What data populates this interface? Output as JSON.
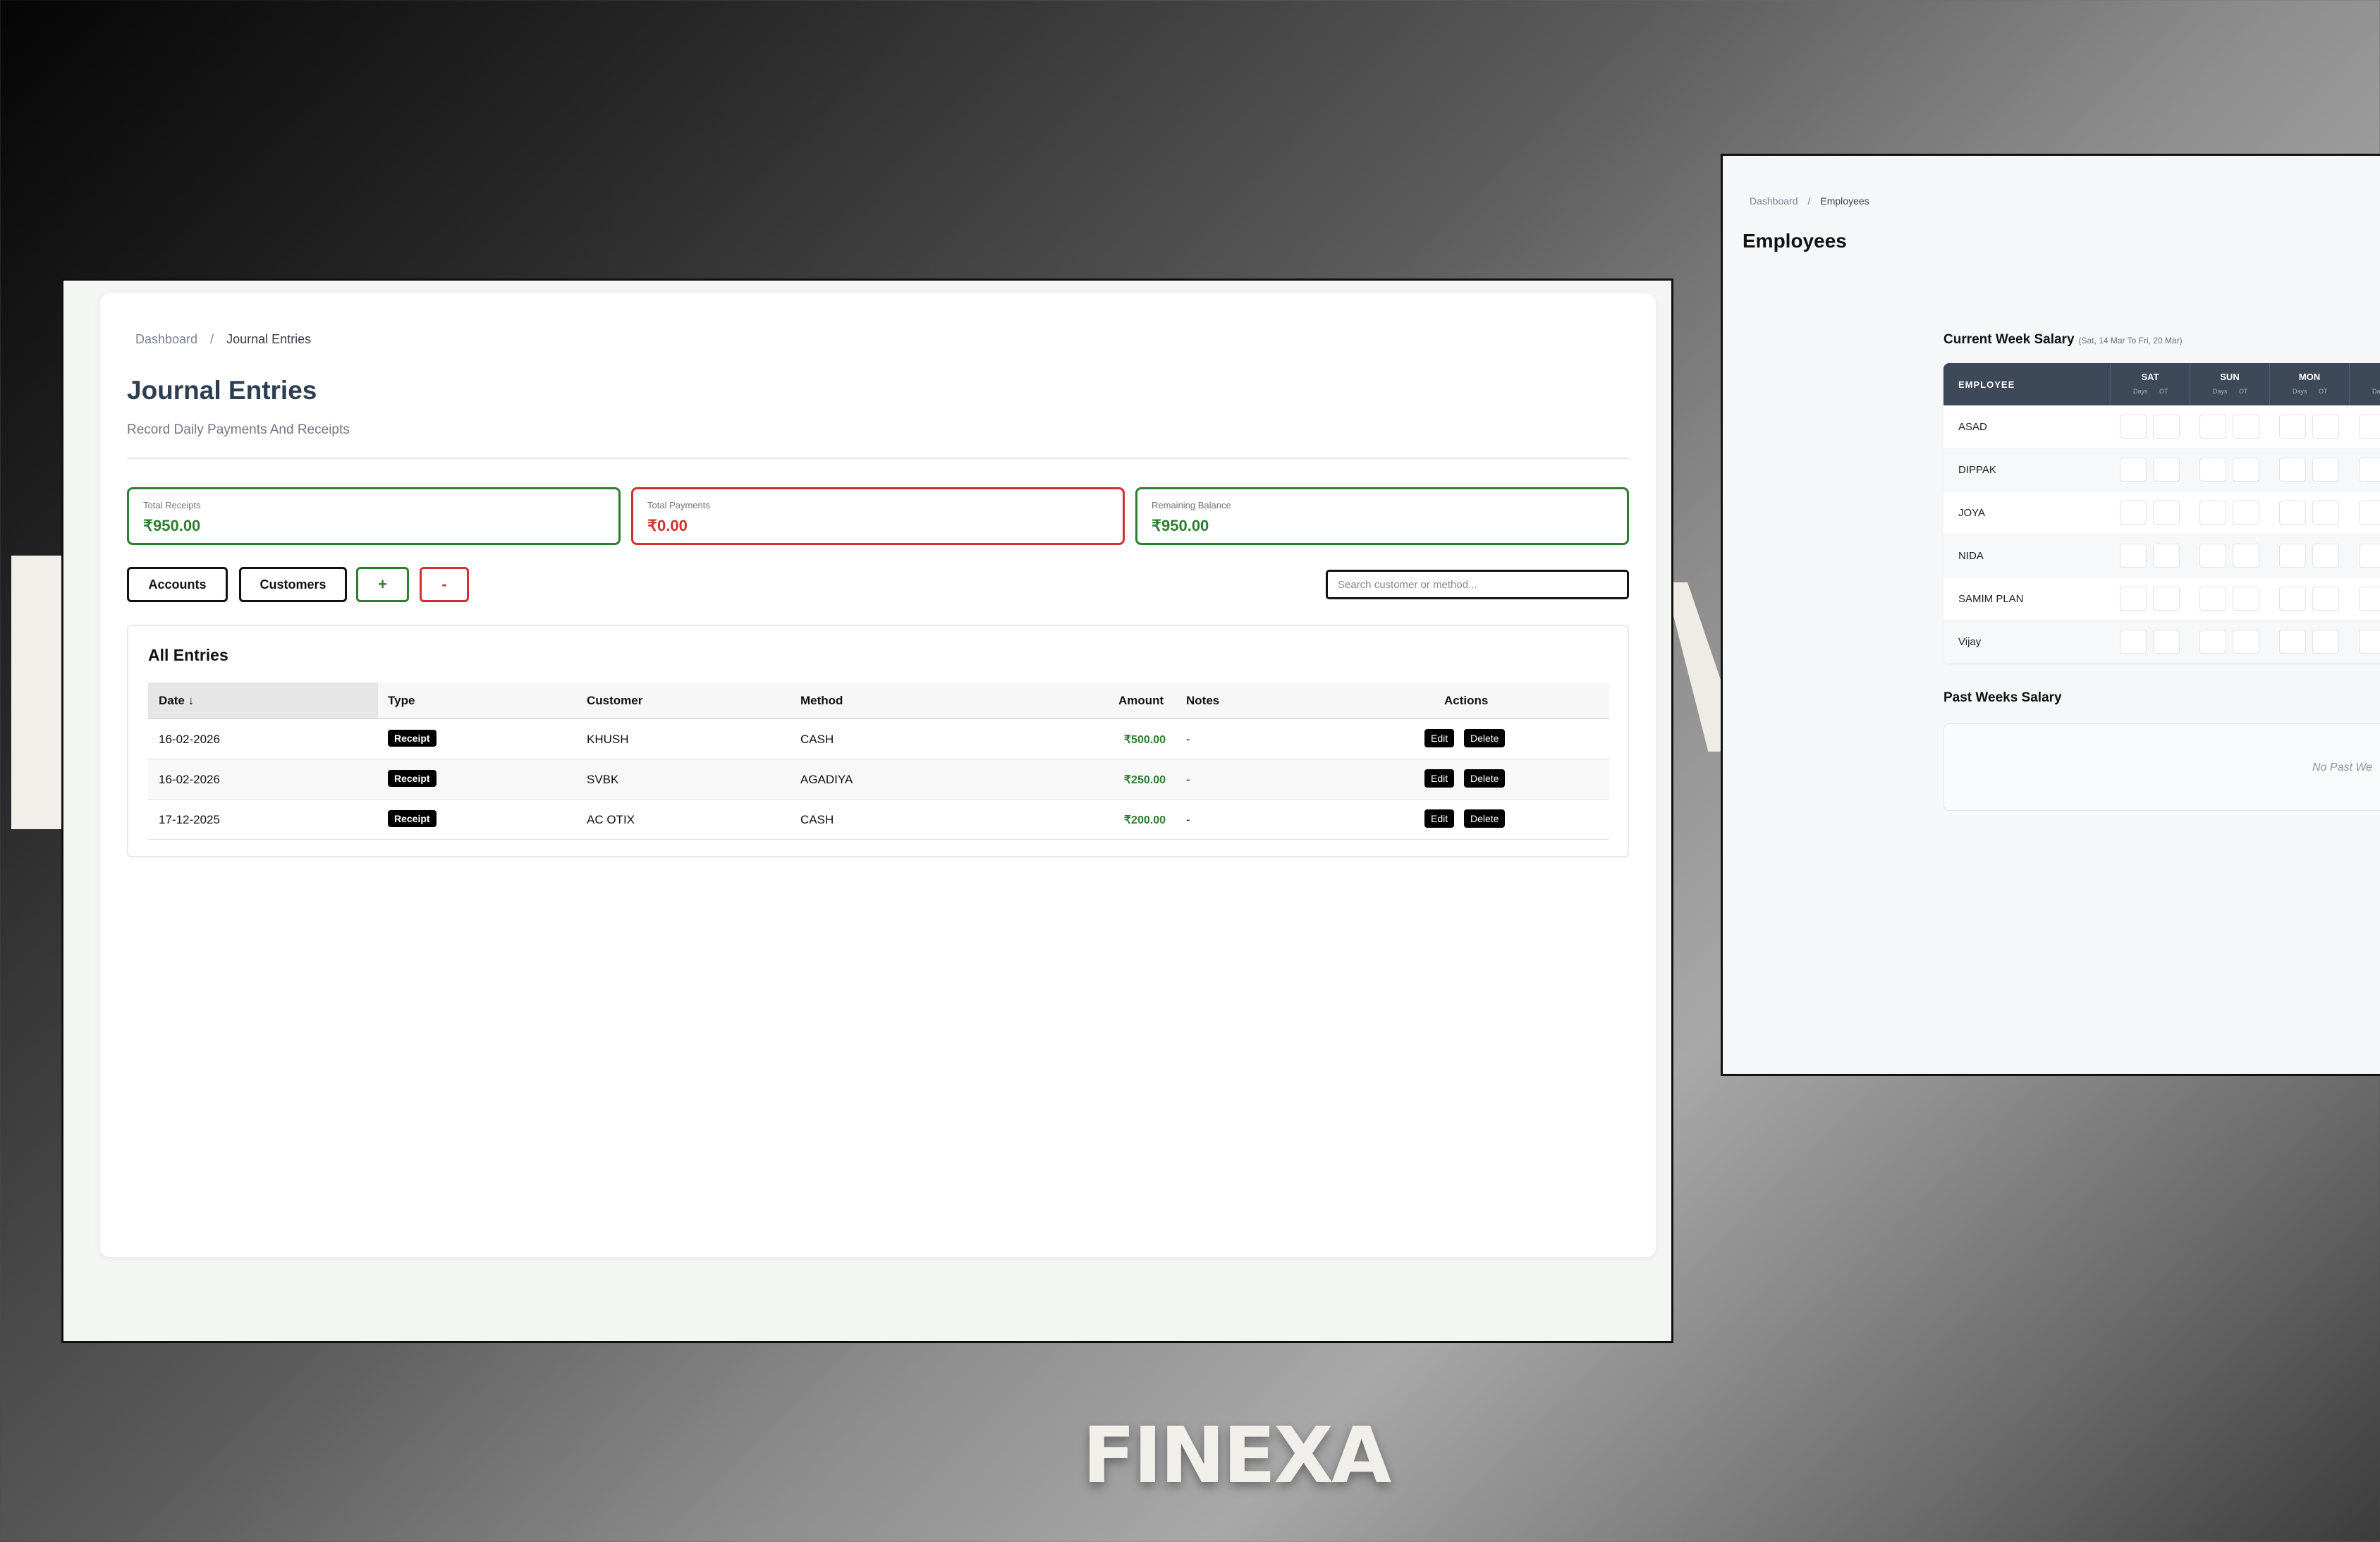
{
  "main": {
    "breadcrumb": {
      "home": "Dashboard",
      "separator": "/",
      "current": "Journal Entries"
    },
    "title": "Journal Entries",
    "subtitle": "Record Daily Payments And Receipts",
    "stats": [
      {
        "label": "Total Receipts",
        "value": "₹950.00",
        "color": "#2e7d32"
      },
      {
        "label": "Total Payments",
        "value": "₹0.00",
        "color": "#d32f2f"
      },
      {
        "label": "Remaining Balance",
        "value": "₹950.00",
        "color": "#2e7d32"
      }
    ],
    "toolbar": {
      "accounts_label": "Accounts",
      "customers_label": "Customers",
      "add_label": "+",
      "remove_label": "-"
    },
    "search": {
      "placeholder": "Search customer or method...",
      "value": ""
    },
    "entries": {
      "title": "All Entries",
      "columns": [
        "Date ↓",
        "Type",
        "Customer",
        "Method",
        "Amount",
        "Notes",
        "Actions"
      ],
      "action_edit": "Edit",
      "action_delete": "Delete",
      "rows": [
        {
          "date": "16-02-2026",
          "type": "Receipt",
          "customer": "KHUSH",
          "method": "CASH",
          "amount": "₹500.00",
          "notes": "-"
        },
        {
          "date": "16-02-2026",
          "type": "Receipt",
          "customer": "SVBK",
          "method": "AGADIYA",
          "amount": "₹250.00",
          "notes": "-"
        },
        {
          "date": "17-12-2025",
          "type": "Receipt",
          "customer": "AC OTIX",
          "method": "CASH",
          "amount": "₹200.00",
          "notes": "-"
        }
      ]
    }
  },
  "employees": {
    "breadcrumb": {
      "home": "Dashboard",
      "separator": "/",
      "current": "Employees"
    },
    "title": "Employees",
    "current_week": {
      "title": "Current Week Salary",
      "range": "(Sat, 14 Mar To Fri, 20 Mar)",
      "employee_header": "EMPLOYEE",
      "days": [
        "SAT",
        "SUN",
        "MON"
      ],
      "sub_days": "Days",
      "sub_ot": "OT",
      "employees": [
        "ASAD",
        "DIPPAK",
        "JOYA",
        "NIDA",
        "SAMIM PLAN",
        "Vijay"
      ]
    },
    "past_weeks": {
      "title": "Past Weeks Salary",
      "empty": "No Past We"
    }
  },
  "brand": "FINEXA",
  "colors": {
    "positive": "#2e7d32",
    "negative": "#d32f2f",
    "table_header": "#3d4859"
  }
}
